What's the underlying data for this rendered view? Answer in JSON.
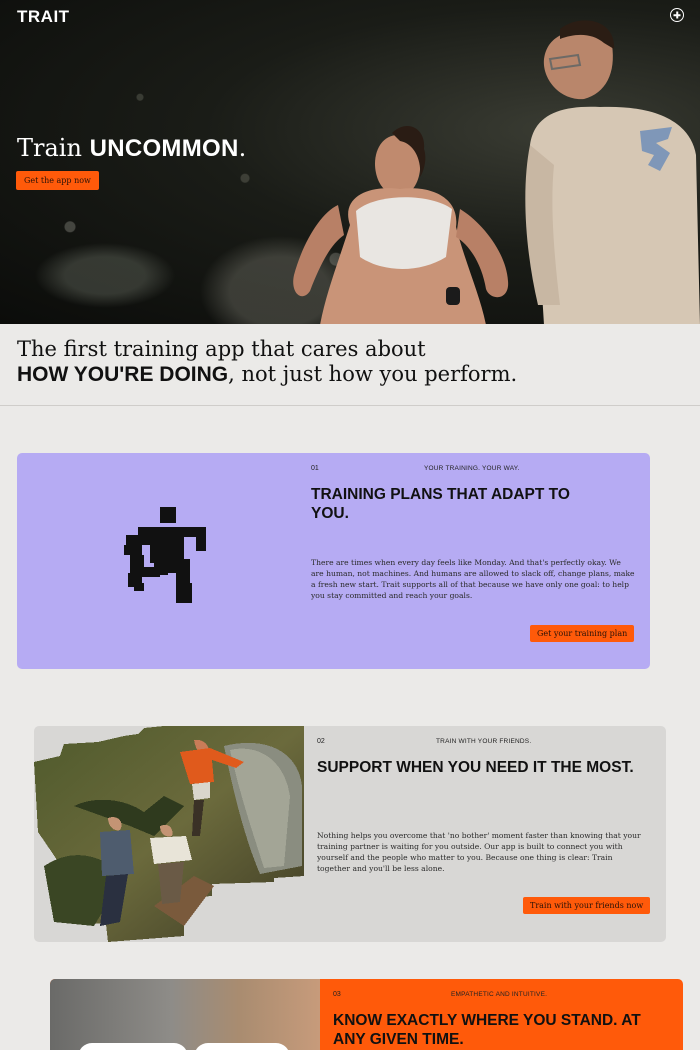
{
  "header": {
    "logo": "TRAIT",
    "menu_icon": "plus-circle-icon"
  },
  "hero": {
    "title_prefix": "Train ",
    "title_bold": "UNCOMMON",
    "title_suffix": ".",
    "cta_label": "Get the app now"
  },
  "tagline": {
    "line1": "The first training app that cares about",
    "line2_bold": "HOW YOU'RE DOING",
    "line2_rest": ", not just how you perform."
  },
  "cards": [
    {
      "number": "01",
      "kicker": "YOUR TRAINING. YOUR WAY.",
      "title": "TRAINING PLANS THAT ADAPT TO YOU.",
      "body": "There are times when every day feels like Monday. And that's perfectly okay. We are human, not machines. And humans are allowed to slack off, change plans, make a fresh new start. Trait supports all of that because we have only one goal: to help you stay committed and reach your goals.",
      "cta": "Get your training plan",
      "icon": "running-figure-icon"
    },
    {
      "number": "02",
      "kicker": "TRAIN WITH YOUR FRIENDS.",
      "title": "SUPPORT WHEN YOU NEED IT THE MOST.",
      "body": "Nothing helps you overcome that 'no bother' moment faster than knowing that your training partner is waiting for you outside. Our app is built to connect you with yourself and the people who matter to you. Because one thing is clear: Train together and you'll be less alone.",
      "cta": "Train with your friends now"
    },
    {
      "number": "03",
      "kicker": "EMPATHETIC AND INTUITIVE.",
      "title": "KNOW EXACTLY WHERE YOU STAND. AT ANY GIVEN TIME."
    }
  ],
  "colors": {
    "accent": "#ff5a0a",
    "card1_bg": "#b6abf3",
    "card2_bg": "#d8d7d5",
    "page_bg": "#ebeae8"
  }
}
